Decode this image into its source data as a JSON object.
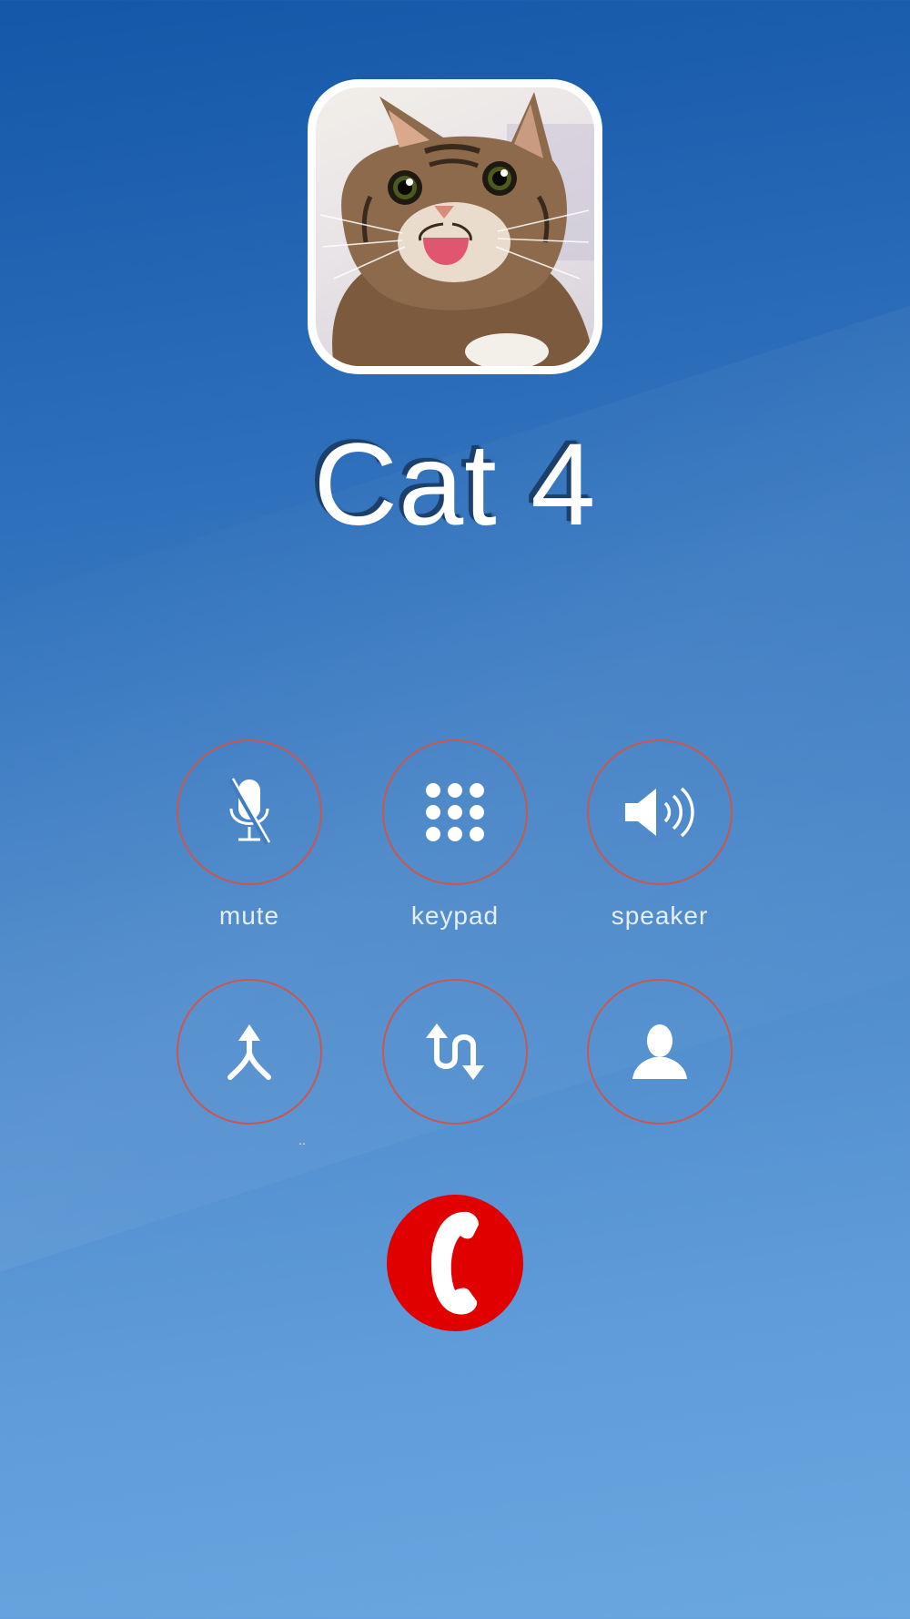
{
  "contact": {
    "name": "Cat 4",
    "avatar": "cat-photo"
  },
  "controls": {
    "mute": {
      "label": "mute",
      "icon": "microphone-muted-icon"
    },
    "keypad": {
      "label": "keypad",
      "icon": "keypad-dots-icon"
    },
    "speaker": {
      "label": "speaker",
      "icon": "speaker-icon"
    },
    "merge": {
      "label": "..",
      "icon": "merge-calls-icon"
    },
    "swap": {
      "label": "",
      "icon": "swap-calls-icon"
    },
    "contacts": {
      "label": "",
      "icon": "contact-person-icon"
    }
  },
  "end_call": {
    "icon": "phone-handset-icon",
    "color": "#e00000"
  },
  "colors": {
    "ring": "#c8584f",
    "background_top": "#1457a8",
    "background_bottom": "#6aa7e0"
  }
}
